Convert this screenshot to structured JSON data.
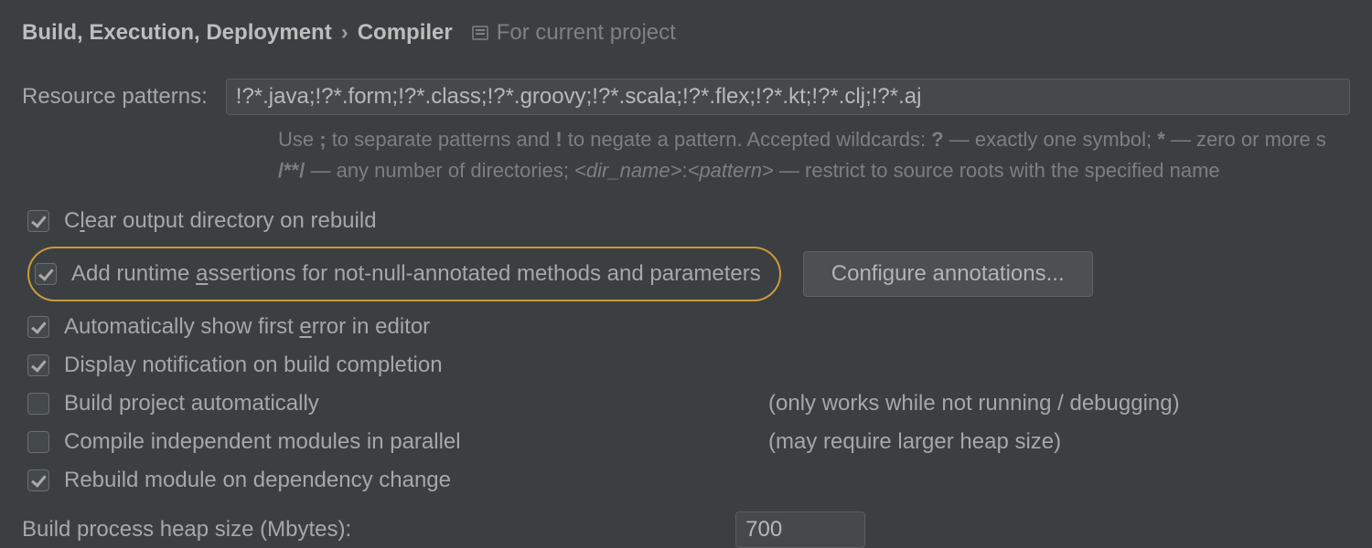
{
  "breadcrumb": {
    "parent": "Build, Execution, Deployment",
    "separator": "›",
    "current": "Compiler",
    "scope_label": "For current project"
  },
  "resource_patterns": {
    "label": "Resource patterns:",
    "value": "!?*.java;!?*.form;!?*.class;!?*.groovy;!?*.scala;!?*.flex;!?*.kt;!?*.clj;!?*.aj"
  },
  "hint": {
    "l1_a": "Use ",
    "l1_b": ";",
    "l1_c": " to separate patterns and ",
    "l1_d": "!",
    "l1_e": " to negate a pattern. Accepted wildcards: ",
    "l1_f": "?",
    "l1_g": " — exactly one symbol; ",
    "l1_h": "*",
    "l1_i": " — zero or more s",
    "l2_a": "/**/",
    "l2_b": " — any number of directories; ",
    "l2_c": "<dir_name>",
    "l2_d": ":",
    "l2_e": "<pattern>",
    "l2_f": " — restrict to source roots with the specified name"
  },
  "options": {
    "clear_output": "Clear output directory on rebuild",
    "add_assertions": "Add runtime assertions for not-null-annotated methods and parameters",
    "configure_button": "Configure annotations...",
    "auto_show_error": "Automatically show first error in editor",
    "display_notif": "Display notification on build completion",
    "build_auto": "Build project automatically",
    "build_auto_hint": "(only works while not running / debugging)",
    "compile_parallel": "Compile independent modules in parallel",
    "compile_parallel_hint": "(may require larger heap size)",
    "rebuild_dep": "Rebuild module on dependency change"
  },
  "heap": {
    "label": "Build process heap size (Mbytes):",
    "value": "700"
  }
}
